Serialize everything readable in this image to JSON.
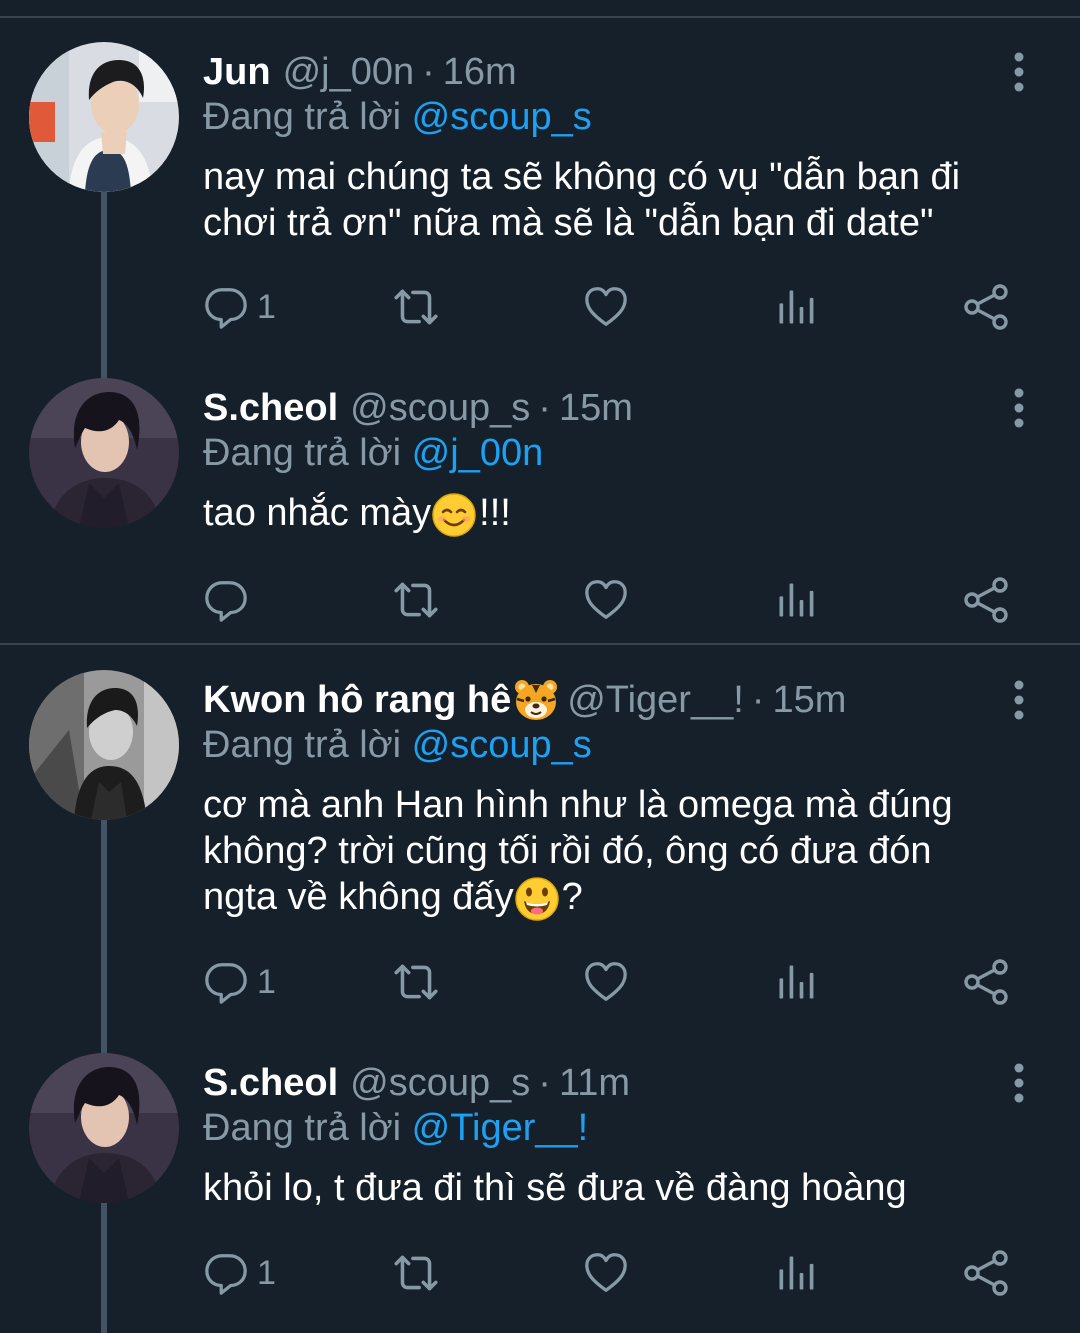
{
  "colors": {
    "background": "#15202b",
    "divider": "#38444d",
    "secondary_text": "#8899a6",
    "link": "#1da1f2"
  },
  "tweets": [
    {
      "name": "Jun",
      "handle": "@j_00n",
      "separator": "·",
      "time": "16m",
      "reply_prefix": "Đang trả lời",
      "reply_to": "@scoup_s",
      "text_1": "nay mai chúng ta sẽ không có vụ \"dẫn bạn đi",
      "text_2": "chơi trả ơn\" nữa mà sẽ là \"dẫn bạn đi date\"",
      "reply_count": "1",
      "icons": [
        "reply-icon",
        "retweet-icon",
        "like-icon",
        "analytics-icon",
        "share-icon",
        "more-icon"
      ]
    },
    {
      "name": "S.cheol",
      "handle": "@scoup_s",
      "separator": "·",
      "time": "15m",
      "reply_prefix": "Đang trả lời",
      "reply_to": "@j_00n",
      "text_1a": "tao nhắc mày",
      "emoji": "smiling-face-emoji",
      "text_1b": "!!!",
      "reply_count": ""
    },
    {
      "name": "Kwon hô rang hê",
      "name_emoji": "tiger-face-emoji",
      "handle": "@Tiger__!",
      "separator": "·",
      "time": "15m",
      "reply_prefix": "Đang trả lời",
      "reply_to": "@scoup_s",
      "text_1": "cơ mà anh Han hình như là omega mà đúng",
      "text_2": "không? trời cũng tối rồi đó, ông có đưa đón",
      "text_3a": "ngta về không đấy",
      "emoji": "grinning-tongue-emoji",
      "text_3b": "?",
      "reply_count": "1"
    },
    {
      "name": "S.cheol",
      "handle": "@scoup_s",
      "separator": "·",
      "time": "11m",
      "reply_prefix": "Đang trả lời",
      "reply_to": "@Tiger__!",
      "text_1": "khỏi lo, t đưa đi thì sẽ đưa về đàng hoàng",
      "reply_count": "1"
    }
  ]
}
